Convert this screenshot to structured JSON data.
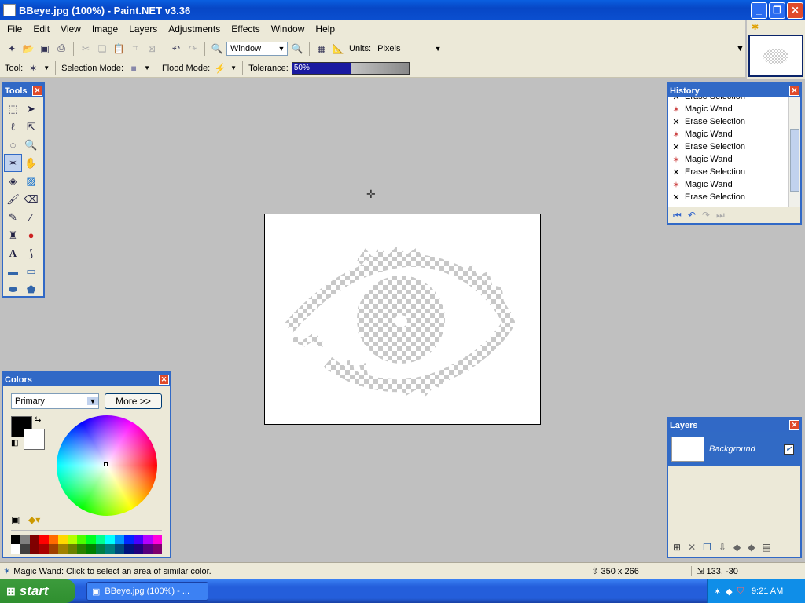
{
  "window": {
    "title": "BBeye.jpg (100%) - Paint.NET v3.36",
    "minimize": "_",
    "maximize": "❐",
    "close": "✕"
  },
  "menu": [
    "File",
    "Edit",
    "View",
    "Image",
    "Layers",
    "Adjustments",
    "Effects",
    "Window",
    "Help"
  ],
  "toolbar": {
    "zoom_value": "Window",
    "units_label": "Units:",
    "units_value": "Pixels"
  },
  "toolbar2": {
    "tool_label": "Tool:",
    "selection_mode_label": "Selection Mode:",
    "flood_mode_label": "Flood Mode:",
    "tolerance_label": "Tolerance:",
    "tolerance_value": "50%",
    "tolerance_fraction": 0.5
  },
  "tools_panel": {
    "title": "Tools",
    "close": "✕"
  },
  "history_panel": {
    "title": "History",
    "close": "✕",
    "items": [
      {
        "label": "Erase Selection",
        "icon": "erase-icon"
      },
      {
        "label": "Magic Wand",
        "icon": "magic-wand-icon"
      },
      {
        "label": "Erase Selection",
        "icon": "erase-icon"
      },
      {
        "label": "Magic Wand",
        "icon": "magic-wand-icon"
      },
      {
        "label": "Erase Selection",
        "icon": "erase-icon"
      },
      {
        "label": "Magic Wand",
        "icon": "magic-wand-icon"
      },
      {
        "label": "Erase Selection",
        "icon": "erase-icon"
      },
      {
        "label": "Magic Wand",
        "icon": "magic-wand-icon"
      },
      {
        "label": "Erase Selection",
        "icon": "erase-icon"
      }
    ]
  },
  "colors_panel": {
    "title": "Colors",
    "close": "✕",
    "mode": "Primary",
    "more_button": "More >>",
    "primary_color": "#000000",
    "secondary_color": "#ffffff"
  },
  "layers_panel": {
    "title": "Layers",
    "close": "✕",
    "layer_name": "Background",
    "accent": "#316ac5"
  },
  "status": {
    "message": "Magic Wand: Click to select an area of similar color.",
    "image_size": "350 x 266",
    "cursor_pos": "133, -30"
  },
  "taskbar": {
    "start_label": "start",
    "task_label": "BBeye.jpg (100%) - ...",
    "clock": "9:21 AM"
  }
}
